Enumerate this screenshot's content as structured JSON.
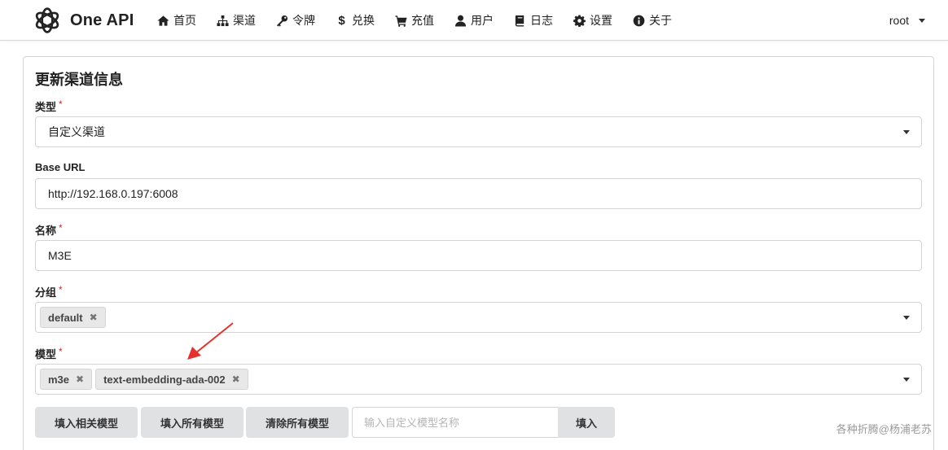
{
  "app": {
    "name": "One API"
  },
  "nav": {
    "items": [
      {
        "label": "首页",
        "icon": "home-icon"
      },
      {
        "label": "渠道",
        "icon": "sitemap-icon"
      },
      {
        "label": "令牌",
        "icon": "key-icon"
      },
      {
        "label": "兑换",
        "icon": "dollar-icon"
      },
      {
        "label": "充值",
        "icon": "cart-icon"
      },
      {
        "label": "用户",
        "icon": "user-icon"
      },
      {
        "label": "日志",
        "icon": "book-icon"
      },
      {
        "label": "设置",
        "icon": "gear-icon"
      },
      {
        "label": "关于",
        "icon": "info-icon"
      }
    ],
    "user": "root"
  },
  "form": {
    "title": "更新渠道信息",
    "type": {
      "label": "类型",
      "value": "自定义渠道"
    },
    "base_url": {
      "label": "Base URL",
      "value": "http://192.168.0.197:6008"
    },
    "name": {
      "label": "名称",
      "value": "M3E"
    },
    "group": {
      "label": "分组",
      "chips": [
        "default"
      ]
    },
    "models": {
      "label": "模型",
      "chips": [
        "m3e",
        "text-embedding-ada-002"
      ]
    },
    "required_mark": "*"
  },
  "actions": {
    "fill_related": "填入相关模型",
    "fill_all": "填入所有模型",
    "clear_all": "清除所有模型",
    "custom_placeholder": "输入自定义模型名称",
    "fill": "填入"
  },
  "watermark": "各种折腾@杨浦老苏",
  "colors": {
    "required": "#db2828",
    "annotation_arrow": "#e5322d"
  }
}
